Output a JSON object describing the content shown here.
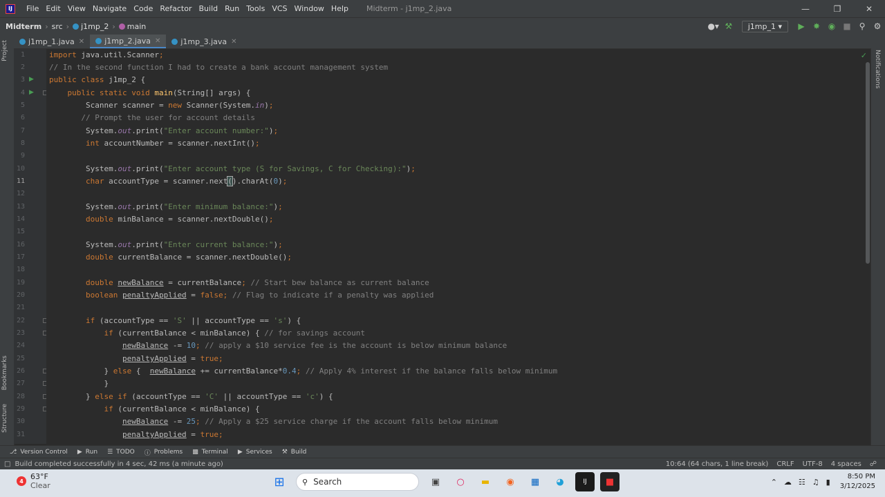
{
  "app": {
    "logo": "IJ",
    "window_title": "Midterm - j1mp_2.java",
    "menu": [
      "File",
      "Edit",
      "View",
      "Navigate",
      "Code",
      "Refactor",
      "Build",
      "Run",
      "Tools",
      "VCS",
      "Window",
      "Help"
    ]
  },
  "navbar": {
    "project": "Midterm",
    "folder": "src",
    "file": "j1mp_2",
    "method": "main",
    "run_config": "j1mp_1"
  },
  "side": {
    "left_top": "Project",
    "left_mid": "Bookmarks",
    "left_bottom": "Structure",
    "right": "Notifications"
  },
  "tabs": [
    {
      "label": "j1mp_1.java",
      "active": false
    },
    {
      "label": "j1mp_2.java",
      "active": true
    },
    {
      "label": "j1mp_3.java",
      "active": false
    }
  ],
  "code": {
    "line_numbers": [
      "1",
      "2",
      "3",
      "4",
      "5",
      "6",
      "7",
      "8",
      "9",
      "10",
      "11",
      "12",
      "13",
      "14",
      "15",
      "16",
      "17",
      "18",
      "19",
      "20",
      "21",
      "22",
      "23",
      "24",
      "25",
      "26",
      "27",
      "28",
      "29",
      "30",
      "31"
    ],
    "current_line": 11,
    "run_markers": [
      3,
      4
    ],
    "fold_markers": [
      4,
      22,
      23,
      26,
      27,
      28,
      29
    ]
  },
  "toolwindows": [
    "Version Control",
    "Run",
    "TODO",
    "Problems",
    "Terminal",
    "Services",
    "Build"
  ],
  "status": {
    "message": "Build completed successfully in 4 sec, 42 ms (a minute ago)",
    "position": "10:64 (64 chars, 1 line break)",
    "line_sep": "CRLF",
    "encoding": "UTF-8",
    "indent": "4 spaces"
  },
  "taskbar": {
    "weather_badge": "4",
    "temp": "63°F",
    "condition": "Clear",
    "search": "Search",
    "time": "8:50 PM",
    "date": "3/12/2025"
  },
  "colors": {
    "keyword": "#cc7832",
    "string": "#6a8759",
    "comment": "#808080",
    "number": "#6897bb",
    "static_field": "#9876aa",
    "method_decl": "#ffc66d"
  }
}
